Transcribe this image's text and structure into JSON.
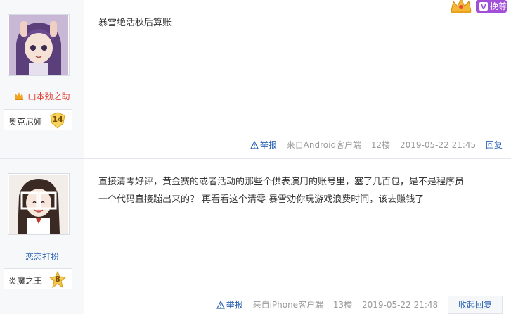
{
  "top_bar": {
    "vip_label": "挽尊"
  },
  "posts": [
    {
      "username": "山本劲之助",
      "badge_text": "奥克尼娅",
      "level": "14",
      "content_lines": [
        "暴雪绝活秋后算账"
      ],
      "report_label": "举报",
      "source": "来自Android客户端",
      "floor": "12楼",
      "timestamp": "2019-05-22 21:45",
      "reply_label": "回复"
    },
    {
      "username": "恋恋打扮",
      "badge_text": "炎魔之王",
      "level": "8",
      "content_lines": [
        "直接清零好评，黄金赛的或者活动的那些个供表演用的账号里，塞了几百包，是不是程序员",
        "一个代码直接蹦出来的？ 再看看这个清零 暴雪劝你玩游戏浪费时间，该去赚钱了"
      ],
      "report_label": "举报",
      "source": "来自iPhone客户端",
      "floor": "13楼",
      "timestamp": "2019-05-22 21:48",
      "reply_label": "收起回复"
    }
  ],
  "colors": {
    "vip_name": "#e23a2e",
    "normal_name": "#2d64b3",
    "link": "#2d64b3",
    "meta": "#999999",
    "vip_button": "#a24fd8"
  }
}
